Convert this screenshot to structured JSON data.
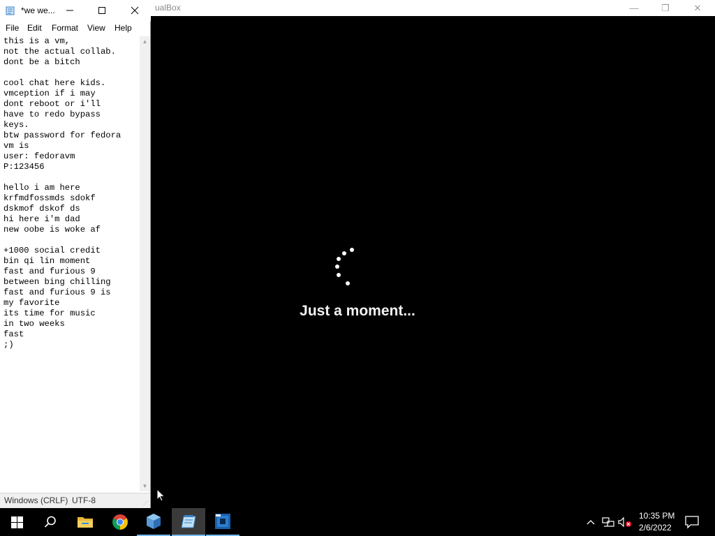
{
  "virtualbox": {
    "title": "ualBox",
    "minimize_glyph": "—",
    "restore_glyph": "❐",
    "close_glyph": "✕"
  },
  "vm": {
    "loading_text": "Just a moment..."
  },
  "notepad": {
    "title": "*we we...",
    "menu": {
      "file": "File",
      "edit": "Edit",
      "format": "Format",
      "view": "View",
      "help": "Help"
    },
    "text": "this is a vm,\nnot the actual collab.\ndont be a bitch\n\ncool chat here kids.\nvmception if i may\ndont reboot or i'll\nhave to redo bypass\nkeys.\nbtw password for fedora\nvm is\nuser: fedoravm\nP:123456\n\nhello i am here\nkrfmdfossmds sdokf\ndskmof dskof ds\nhi here i'm dad\nnew oobe is woke af\n\n+1000 social credit\nbin qi lin moment\nfast and furious 9\nbetween bing chilling\nfast and furious 9 is\nmy favorite\nits time for music\nin two weeks\nfast\n;)",
    "status": {
      "line_ending": "Windows (CRLF)",
      "encoding": "UTF-8"
    }
  },
  "taskbar": {
    "apps": [
      {
        "name": "start",
        "icon": "windows-logo-icon"
      },
      {
        "name": "search",
        "icon": "search-icon"
      },
      {
        "name": "file-explorer",
        "icon": "folder-icon"
      },
      {
        "name": "chrome",
        "icon": "chrome-icon"
      },
      {
        "name": "virtualbox",
        "icon": "virtualbox-icon",
        "running": true
      },
      {
        "name": "notepad",
        "icon": "notepad-icon",
        "running": true,
        "active": true
      },
      {
        "name": "cpu-z",
        "icon": "cpuz-icon"
      }
    ],
    "clock": {
      "time": "10:35 PM",
      "date": "2/6/2022"
    }
  },
  "colors": {
    "taskbar_bg": "#000000",
    "running_indicator": "#76b9ed",
    "vm_screen_bg": "#000000",
    "mute_badge": "#e81123"
  }
}
